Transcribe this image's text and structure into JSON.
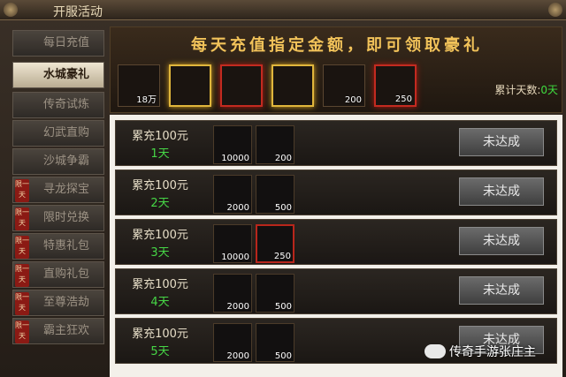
{
  "title": "开服活动",
  "sidebar": {
    "items": [
      {
        "label": "每日充值",
        "active": false,
        "limited": false
      },
      {
        "label": "水城豪礼",
        "active": true,
        "limited": false
      },
      {
        "label": "传奇试炼",
        "active": false,
        "limited": false
      },
      {
        "label": "幻武直购",
        "active": false,
        "limited": false
      },
      {
        "label": "沙城争霸",
        "active": false,
        "limited": false
      },
      {
        "label": "寻龙探宝",
        "active": false,
        "limited": true
      },
      {
        "label": "限时兑换",
        "active": false,
        "limited": true
      },
      {
        "label": "特惠礼包",
        "active": false,
        "limited": true
      },
      {
        "label": "直购礼包",
        "active": false,
        "limited": true
      },
      {
        "label": "至尊浩劫",
        "active": false,
        "limited": true
      },
      {
        "label": "霸主狂欢",
        "active": false,
        "limited": true
      }
    ],
    "limited_tag": "限一天"
  },
  "banner": "每天充值指定金额，即可领取豪礼",
  "rewards": [
    {
      "icon": "book-icon",
      "qty": "18万",
      "frame": "none"
    },
    {
      "icon": "helmet-icon",
      "qty": "",
      "frame": "gold"
    },
    {
      "icon": "chest-icon",
      "qty": "",
      "frame": "red"
    },
    {
      "icon": "chest-icon",
      "qty": "",
      "frame": "gold"
    },
    {
      "icon": "gold-shard-icon",
      "qty": "200",
      "frame": "none"
    },
    {
      "icon": "weapon-icon",
      "qty": "250",
      "frame": "red"
    }
  ],
  "days_label": "累计天数:",
  "days_value": "0天",
  "rows": [
    {
      "req": "累充100元",
      "day": "1天",
      "items": [
        {
          "icon": "book-icon",
          "qty": "10000",
          "frame": "none"
        },
        {
          "icon": "gold-shard-icon",
          "qty": "200",
          "frame": "none"
        }
      ],
      "button": "未达成"
    },
    {
      "req": "累充100元",
      "day": "2天",
      "items": [
        {
          "icon": "book-icon",
          "qty": "2000",
          "frame": "none"
        },
        {
          "icon": "blue-orb-icon",
          "qty": "500",
          "frame": "none"
        }
      ],
      "button": "未达成"
    },
    {
      "req": "累充100元",
      "day": "3天",
      "items": [
        {
          "icon": "book-icon",
          "qty": "10000",
          "frame": "none"
        },
        {
          "icon": "weapon-icon",
          "qty": "250",
          "frame": "red"
        }
      ],
      "button": "未达成"
    },
    {
      "req": "累充100元",
      "day": "4天",
      "items": [
        {
          "icon": "book-icon",
          "qty": "2000",
          "frame": "none"
        },
        {
          "icon": "crystal-icon",
          "qty": "500",
          "frame": "none"
        }
      ],
      "button": "未达成"
    },
    {
      "req": "累充100元",
      "day": "5天",
      "items": [
        {
          "icon": "book-icon",
          "qty": "2000",
          "frame": "none"
        },
        {
          "icon": "blue-orb-icon",
          "qty": "500",
          "frame": "none"
        }
      ],
      "button": "未达成"
    }
  ],
  "watermark": "传奇手游张庄主"
}
